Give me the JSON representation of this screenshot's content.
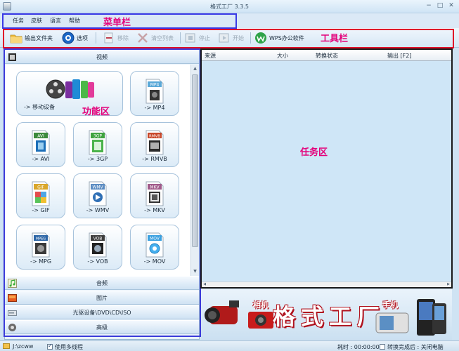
{
  "window": {
    "title": "格式工厂 3.3.5",
    "minimize": "−",
    "maximize": "□",
    "close": "✕"
  },
  "menu": {
    "items": [
      "任务",
      "皮肤",
      "语言",
      "帮助"
    ]
  },
  "toolbar": {
    "output_folder": "输出文件夹",
    "options": "选项",
    "remove": "移除",
    "clear_list": "清空列表",
    "stop": "停止",
    "start": "开始",
    "wps": "WPS办公软件"
  },
  "annotations": {
    "menubar": "菜单栏",
    "toolbar": "工具栏",
    "function_area": "功能区",
    "task_area": "任务区"
  },
  "categories": {
    "video": "视频",
    "audio": "音频",
    "picture": "图片",
    "rom": "光驱设备\\DVD\\CD\\ISO",
    "advanced": "高级"
  },
  "formats": [
    {
      "label": "-> 移动设备",
      "icon": "mobile-devices-icon"
    },
    {
      "label": "-> MP4",
      "badge": "MP4",
      "icon": "mp4-icon"
    },
    {
      "label": "-> AVI",
      "badge": "AVI",
      "icon": "avi-icon"
    },
    {
      "label": "-> 3GP",
      "badge": "3GP",
      "icon": "3gp-icon"
    },
    {
      "label": "-> RMVB",
      "badge": "RMVB",
      "icon": "rmvb-icon"
    },
    {
      "label": "-> GIF",
      "badge": "GIF",
      "icon": "gif-icon"
    },
    {
      "label": "-> WMV",
      "badge": "WMV",
      "icon": "wmv-icon"
    },
    {
      "label": "-> MKV",
      "badge": "MKV",
      "icon": "mkv-icon"
    },
    {
      "label": "-> MPG",
      "badge": "MPEG",
      "icon": "mpg-icon"
    },
    {
      "label": "-> VOB",
      "badge": "VOB",
      "icon": "vob-icon"
    },
    {
      "label": "-> MOV",
      "badge": "MOV",
      "icon": "mov-icon"
    }
  ],
  "task_table": {
    "columns": [
      "来源",
      "大小",
      "转换状态",
      "输出 [F2]"
    ]
  },
  "banner": {
    "title": "格式工厂",
    "camera": "相机",
    "phone": "手机"
  },
  "status": {
    "output_path": "J:\\zcww",
    "multithread": "使用多线程",
    "elapsed": "耗时 : 00:00:00",
    "after_convert": "转换完成后 : 关闭电脑"
  },
  "colors": {
    "annotation_text": "#e4007a",
    "annotation_menu_frame": "#3a3ae6",
    "annotation_toolbar_frame": "#e0102a",
    "annotation_func_frame": "#3b3bd9",
    "annotation_task_frame": "#1a1a1a"
  }
}
